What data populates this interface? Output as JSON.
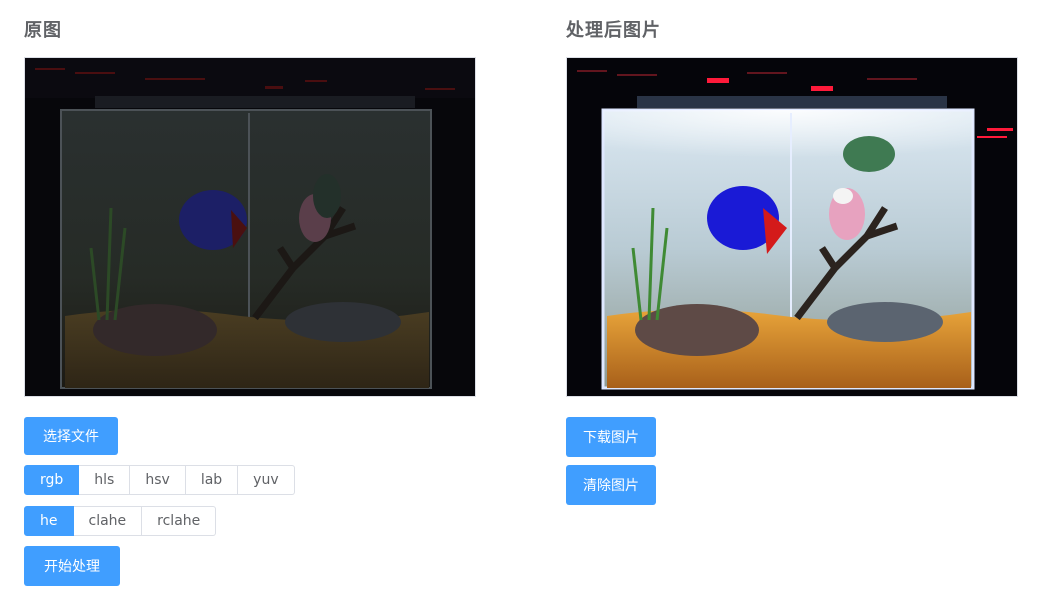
{
  "original": {
    "title": "原图",
    "select_file_label": "选择文件",
    "colorspace_options": [
      "rgb",
      "hls",
      "hsv",
      "lab",
      "yuv"
    ],
    "colorspace_selected": "rgb",
    "method_options": [
      "he",
      "clahe",
      "rclahe"
    ],
    "method_selected": "he",
    "start_label": "开始处理"
  },
  "processed": {
    "title": "处理后图片",
    "download_label": "下载图片",
    "clear_label": "清除图片"
  },
  "colors": {
    "primary": "#409eff",
    "border": "#dcdfe6",
    "title_text": "#606266"
  }
}
